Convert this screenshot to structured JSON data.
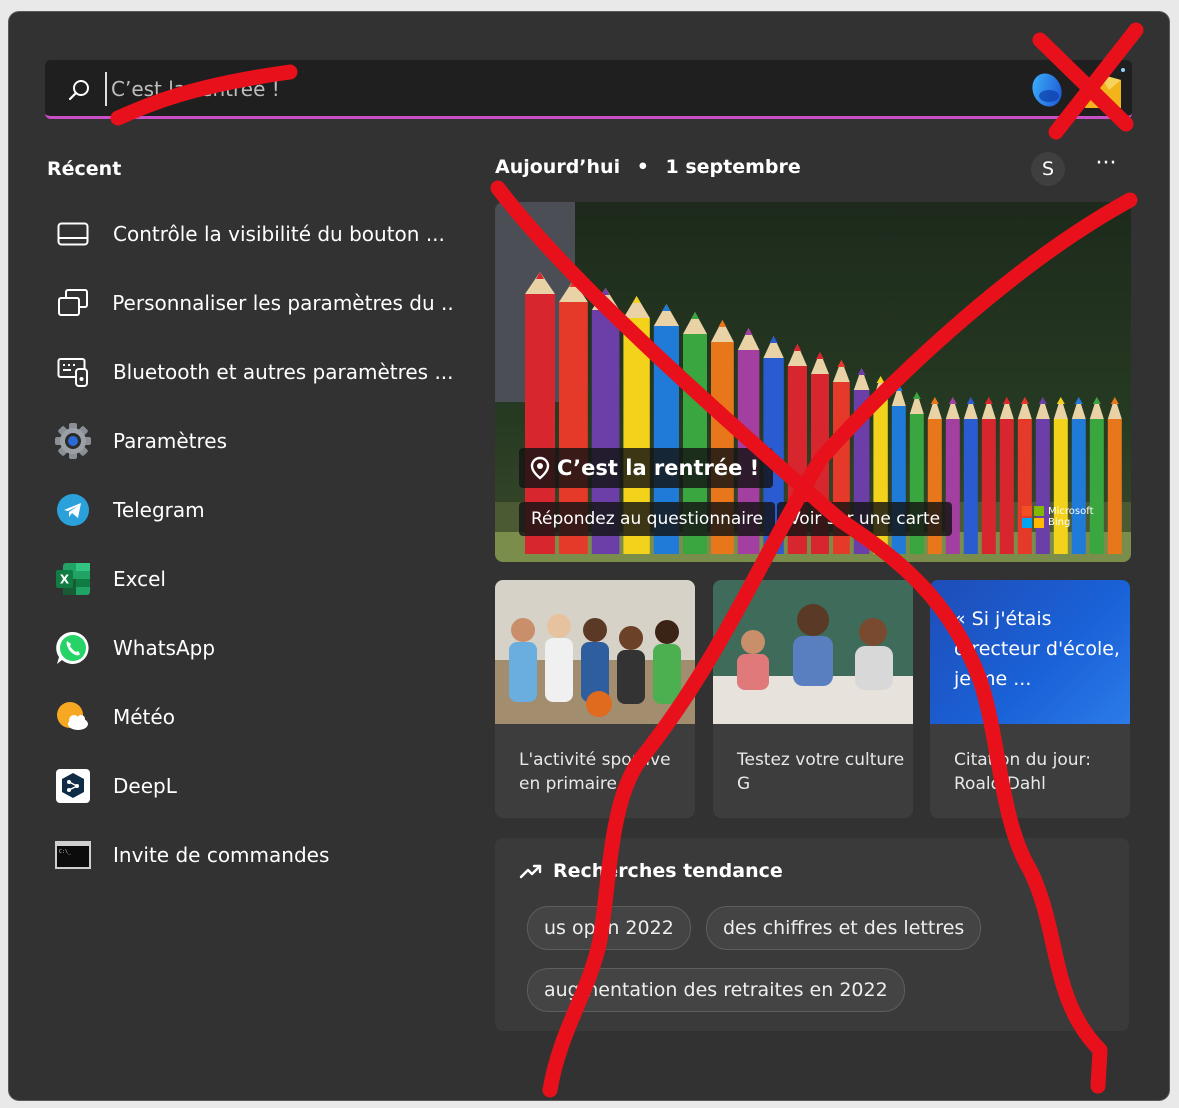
{
  "search": {
    "value": "C’est la rentrée !"
  },
  "recent": {
    "title": "Récent",
    "items": [
      {
        "label": "Contrôle la visibilité du bouton ...",
        "icon": "taskbar-icon"
      },
      {
        "label": "Personnaliser les paramètres du ...",
        "icon": "windows-copy-icon"
      },
      {
        "label": "Bluetooth et autres paramètres ...",
        "icon": "devices-icon"
      },
      {
        "label": "Paramètres",
        "icon": "gear-icon"
      },
      {
        "label": "Telegram",
        "icon": "telegram-icon"
      },
      {
        "label": "Excel",
        "icon": "excel-icon"
      },
      {
        "label": "WhatsApp",
        "icon": "whatsapp-icon"
      },
      {
        "label": "Météo",
        "icon": "weather-icon"
      },
      {
        "label": "DeepL",
        "icon": "deepl-icon"
      },
      {
        "label": "Invite de commandes",
        "icon": "terminal-icon"
      }
    ]
  },
  "today": {
    "label": "Aujourd’hui",
    "separator": "•",
    "date": "1 septembre",
    "avatar_initial": "S",
    "more": "···"
  },
  "hero": {
    "title": "C’est la rentrée !",
    "button_quiz": "Répondez au questionnaire",
    "button_map": "Voir sur une carte",
    "brand_line1": "Microsoft",
    "brand_line2": "Bing"
  },
  "cards": [
    {
      "caption": "L'activité sportive en primaire"
    },
    {
      "caption": "Testez votre culture G"
    },
    {
      "quote": "« Si j'étais directeur d'école, je me ...",
      "caption": "Citation du jour: Roald Dahl"
    }
  ],
  "trends": {
    "title": "Recherches tendance",
    "chips": [
      "us open 2022",
      "des chiffres et des lettres",
      "augmentation des retraites en 2022"
    ]
  },
  "colors": {
    "panel": "#323232",
    "accent_underline": "#c84fc6",
    "annotation": "#e8111b"
  }
}
